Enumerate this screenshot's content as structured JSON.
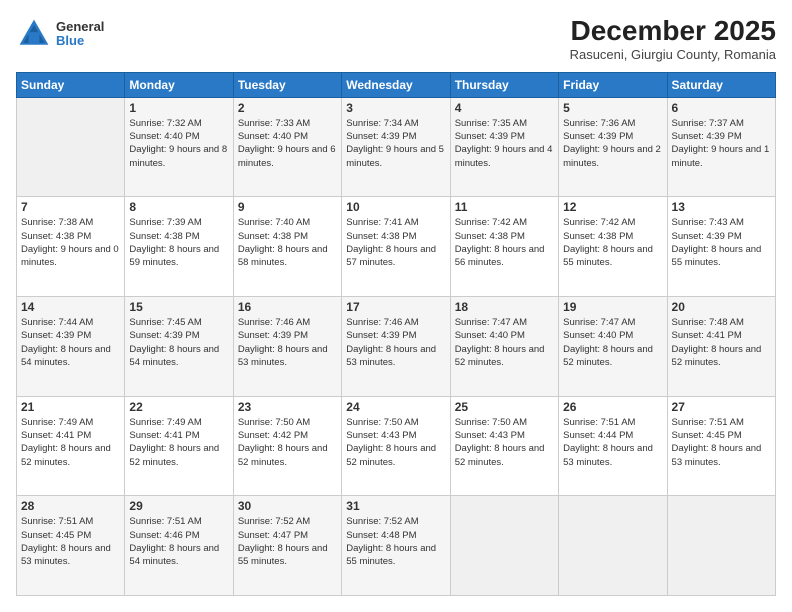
{
  "logo": {
    "general": "General",
    "blue": "Blue"
  },
  "header": {
    "month": "December 2025",
    "location": "Rasuceni, Giurgiu County, Romania"
  },
  "weekdays": [
    "Sunday",
    "Monday",
    "Tuesday",
    "Wednesday",
    "Thursday",
    "Friday",
    "Saturday"
  ],
  "weeks": [
    [
      {
        "day": "",
        "sunrise": "",
        "sunset": "",
        "daylight": ""
      },
      {
        "day": "1",
        "sunrise": "7:32 AM",
        "sunset": "4:40 PM",
        "daylight": "9 hours and 8 minutes."
      },
      {
        "day": "2",
        "sunrise": "7:33 AM",
        "sunset": "4:40 PM",
        "daylight": "9 hours and 6 minutes."
      },
      {
        "day": "3",
        "sunrise": "7:34 AM",
        "sunset": "4:39 PM",
        "daylight": "9 hours and 5 minutes."
      },
      {
        "day": "4",
        "sunrise": "7:35 AM",
        "sunset": "4:39 PM",
        "daylight": "9 hours and 4 minutes."
      },
      {
        "day": "5",
        "sunrise": "7:36 AM",
        "sunset": "4:39 PM",
        "daylight": "9 hours and 2 minutes."
      },
      {
        "day": "6",
        "sunrise": "7:37 AM",
        "sunset": "4:39 PM",
        "daylight": "9 hours and 1 minute."
      }
    ],
    [
      {
        "day": "7",
        "sunrise": "7:38 AM",
        "sunset": "4:38 PM",
        "daylight": "9 hours and 0 minutes."
      },
      {
        "day": "8",
        "sunrise": "7:39 AM",
        "sunset": "4:38 PM",
        "daylight": "8 hours and 59 minutes."
      },
      {
        "day": "9",
        "sunrise": "7:40 AM",
        "sunset": "4:38 PM",
        "daylight": "8 hours and 58 minutes."
      },
      {
        "day": "10",
        "sunrise": "7:41 AM",
        "sunset": "4:38 PM",
        "daylight": "8 hours and 57 minutes."
      },
      {
        "day": "11",
        "sunrise": "7:42 AM",
        "sunset": "4:38 PM",
        "daylight": "8 hours and 56 minutes."
      },
      {
        "day": "12",
        "sunrise": "7:42 AM",
        "sunset": "4:38 PM",
        "daylight": "8 hours and 55 minutes."
      },
      {
        "day": "13",
        "sunrise": "7:43 AM",
        "sunset": "4:39 PM",
        "daylight": "8 hours and 55 minutes."
      }
    ],
    [
      {
        "day": "14",
        "sunrise": "7:44 AM",
        "sunset": "4:39 PM",
        "daylight": "8 hours and 54 minutes."
      },
      {
        "day": "15",
        "sunrise": "7:45 AM",
        "sunset": "4:39 PM",
        "daylight": "8 hours and 54 minutes."
      },
      {
        "day": "16",
        "sunrise": "7:46 AM",
        "sunset": "4:39 PM",
        "daylight": "8 hours and 53 minutes."
      },
      {
        "day": "17",
        "sunrise": "7:46 AM",
        "sunset": "4:39 PM",
        "daylight": "8 hours and 53 minutes."
      },
      {
        "day": "18",
        "sunrise": "7:47 AM",
        "sunset": "4:40 PM",
        "daylight": "8 hours and 52 minutes."
      },
      {
        "day": "19",
        "sunrise": "7:47 AM",
        "sunset": "4:40 PM",
        "daylight": "8 hours and 52 minutes."
      },
      {
        "day": "20",
        "sunrise": "7:48 AM",
        "sunset": "4:41 PM",
        "daylight": "8 hours and 52 minutes."
      }
    ],
    [
      {
        "day": "21",
        "sunrise": "7:49 AM",
        "sunset": "4:41 PM",
        "daylight": "8 hours and 52 minutes."
      },
      {
        "day": "22",
        "sunrise": "7:49 AM",
        "sunset": "4:41 PM",
        "daylight": "8 hours and 52 minutes."
      },
      {
        "day": "23",
        "sunrise": "7:50 AM",
        "sunset": "4:42 PM",
        "daylight": "8 hours and 52 minutes."
      },
      {
        "day": "24",
        "sunrise": "7:50 AM",
        "sunset": "4:43 PM",
        "daylight": "8 hours and 52 minutes."
      },
      {
        "day": "25",
        "sunrise": "7:50 AM",
        "sunset": "4:43 PM",
        "daylight": "8 hours and 52 minutes."
      },
      {
        "day": "26",
        "sunrise": "7:51 AM",
        "sunset": "4:44 PM",
        "daylight": "8 hours and 53 minutes."
      },
      {
        "day": "27",
        "sunrise": "7:51 AM",
        "sunset": "4:45 PM",
        "daylight": "8 hours and 53 minutes."
      }
    ],
    [
      {
        "day": "28",
        "sunrise": "7:51 AM",
        "sunset": "4:45 PM",
        "daylight": "8 hours and 53 minutes."
      },
      {
        "day": "29",
        "sunrise": "7:51 AM",
        "sunset": "4:46 PM",
        "daylight": "8 hours and 54 minutes."
      },
      {
        "day": "30",
        "sunrise": "7:52 AM",
        "sunset": "4:47 PM",
        "daylight": "8 hours and 55 minutes."
      },
      {
        "day": "31",
        "sunrise": "7:52 AM",
        "sunset": "4:48 PM",
        "daylight": "8 hours and 55 minutes."
      },
      {
        "day": "",
        "sunrise": "",
        "sunset": "",
        "daylight": ""
      },
      {
        "day": "",
        "sunrise": "",
        "sunset": "",
        "daylight": ""
      },
      {
        "day": "",
        "sunrise": "",
        "sunset": "",
        "daylight": ""
      }
    ]
  ]
}
